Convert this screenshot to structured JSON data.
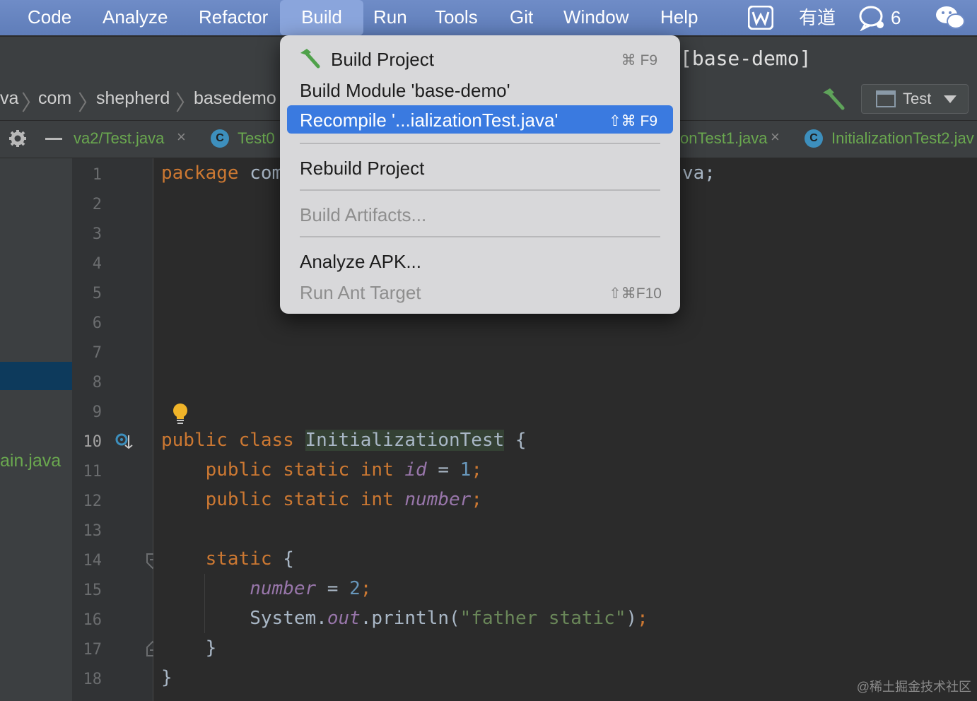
{
  "menubar": {
    "items": [
      "Code",
      "Analyze",
      "Refactor",
      "Build",
      "Run",
      "Tools",
      "Git",
      "Window",
      "Help"
    ],
    "active": "Build",
    "tray": {
      "youdao": "有道",
      "chat_count": "6"
    }
  },
  "titlebar": {
    "project": "[base-demo]"
  },
  "breadcrumb": {
    "items": [
      "va",
      "com",
      "shepherd",
      "basedemo"
    ]
  },
  "toolbar": {
    "run_config": "Test"
  },
  "tabs": [
    {
      "label": "va2/Test.java"
    },
    {
      "label": "Test0"
    },
    {
      "label": "onTest1.java"
    },
    {
      "label": "InitializationTest2.jav"
    }
  ],
  "project_panel": {
    "visible_file": "ain.java"
  },
  "build_menu": {
    "items": [
      {
        "label": "Build Project",
        "shortcut": "⌘ F9"
      },
      {
        "label": "Build Module 'base-demo'",
        "shortcut": ""
      },
      {
        "label": "Recompile '...ializationTest.java'",
        "shortcut": "⇧⌘ F9"
      },
      {
        "label": "Rebuild Project",
        "shortcut": ""
      },
      {
        "label": "Build Artifacts...",
        "shortcut": ""
      },
      {
        "label": "Analyze APK...",
        "shortcut": ""
      },
      {
        "label": "Run Ant Target",
        "shortcut": "⇧⌘F10"
      }
    ]
  },
  "editor": {
    "line_numbers": [
      "1",
      "2",
      "3",
      "4",
      "5",
      "6",
      "7",
      "8",
      "9",
      "10",
      "11",
      "12",
      "13",
      "14",
      "15",
      "16",
      "17",
      "18"
    ],
    "current_line": "10",
    "code": {
      "l1_kw": "package",
      "l1_rest": " com",
      "l1_tail": "va;",
      "l10_kw": "public class",
      "l10_cls": "InitializationTest",
      "l10_brace": " {",
      "l11_kw": "public static int",
      "l11_fld": "id",
      "l11_eq": " = ",
      "l11_num": "1",
      "l11_semi": ";",
      "l12_kw": "public static int",
      "l12_fld": "number",
      "l12_semi": ";",
      "l14_kw": "static",
      "l14_brace": " {",
      "l15_fld": "number",
      "l15_eq": " = ",
      "l15_num": "2",
      "l15_semi": ";",
      "l16_a": "System.",
      "l16_out": "out",
      "l16_b": ".println(",
      "l16_str": "\"father static\"",
      "l16_c": ")",
      "l16_semi": ";",
      "l17": "}",
      "l18": "}"
    }
  },
  "watermark": "@稀土掘金技术社区",
  "colors": {
    "menu_highlight": "#3a7ae0",
    "keyword": "#cc7832",
    "string": "#6a8759",
    "number": "#6897bb",
    "field": "#9876aa"
  }
}
